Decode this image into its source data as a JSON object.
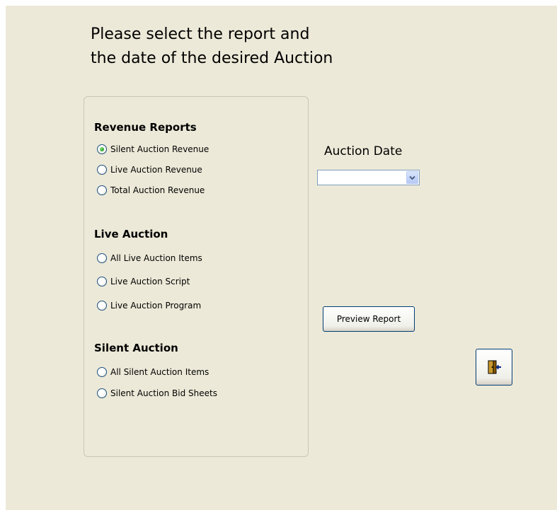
{
  "heading": {
    "line1": "Please select the report and",
    "line2": "the date of the desired Auction"
  },
  "report_groups": {
    "revenue": {
      "title": "Revenue Reports",
      "options": [
        {
          "label": "Silent Auction Revenue",
          "checked": true
        },
        {
          "label": "Live Auction Revenue",
          "checked": false
        },
        {
          "label": "Total Auction Revenue",
          "checked": false
        }
      ]
    },
    "live": {
      "title": "Live Auction",
      "options": [
        {
          "label": "All Live Auction Items",
          "checked": false
        },
        {
          "label": "Live Auction Script",
          "checked": false
        },
        {
          "label": "Live Auction Program",
          "checked": false
        }
      ]
    },
    "silent": {
      "title": "Silent Auction",
      "options": [
        {
          "label": "All Silent Auction Items",
          "checked": false
        },
        {
          "label": "Silent Auction Bid Sheets",
          "checked": false
        }
      ]
    }
  },
  "auction_date": {
    "label": "Auction Date",
    "value": ""
  },
  "buttons": {
    "preview_label": "Preview Report",
    "exit_icon": "exit-door-icon"
  },
  "colors": {
    "form_background": "#ECE9D8",
    "radio_selected": "#21A121",
    "button_border": "#003C74"
  }
}
